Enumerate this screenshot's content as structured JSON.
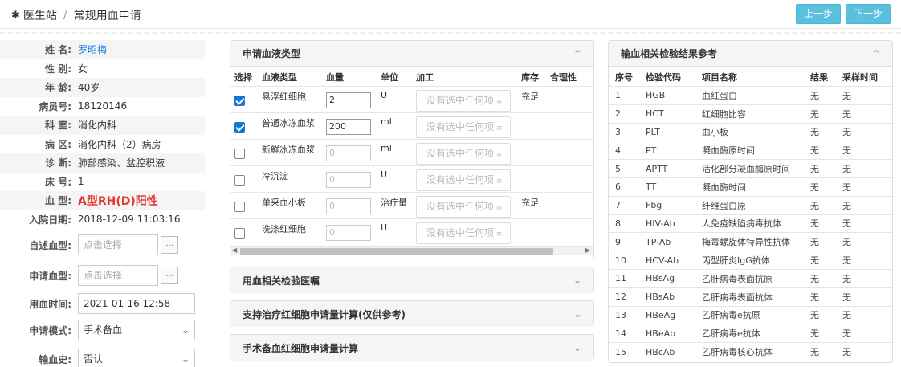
{
  "header": {
    "home": "医生站",
    "sep": "/",
    "page": "常规用血申请",
    "prev_label": "上一步",
    "next_label": "下一步"
  },
  "patient": {
    "fields": [
      {
        "label": "姓 名:",
        "value": "罗昭梅",
        "style": "name"
      },
      {
        "label": "性 别:",
        "value": "女"
      },
      {
        "label": "年 龄:",
        "value": "40岁"
      },
      {
        "label": "病员号:",
        "value": "18120146"
      },
      {
        "label": "科 室:",
        "value": "消化内科"
      },
      {
        "label": "病 区:",
        "value": "消化内科（2）病房"
      },
      {
        "label": "诊 断:",
        "value": "肺部感染、盆腔积液"
      },
      {
        "label": "床 号:",
        "value": "1"
      },
      {
        "label": "血 型:",
        "value": "A型RH(D)阳性",
        "style": "blood"
      },
      {
        "label": "入院日期:",
        "value": "2018-12-09 11:03:16"
      }
    ],
    "self_blood": {
      "label": "自述血型:",
      "placeholder": "点击选择"
    },
    "apply_blood": {
      "label": "申请血型:",
      "placeholder": "点击选择"
    },
    "use_time": {
      "label": "用血时间:",
      "value": "2021-01-16 12:58"
    },
    "mode": {
      "label": "申请模式:",
      "value": "手术备血"
    },
    "transfusion": {
      "label": "输血史:",
      "value": "否认"
    },
    "dots": "..."
  },
  "blood_panel": {
    "title": "申请血液类型",
    "columns": [
      "选择",
      "血液类型",
      "血量",
      "单位",
      "加工",
      "库存",
      "合理性"
    ],
    "proc_placeholder": "没有选中任何项",
    "rows": [
      {
        "checked": true,
        "type": "悬浮红细胞",
        "qty": "2",
        "unit": "U",
        "stock": "充足"
      },
      {
        "checked": true,
        "type": "普通冰冻血浆",
        "qty": "200",
        "unit": "ml",
        "stock": ""
      },
      {
        "checked": false,
        "type": "新鲜冰冻血浆",
        "qty": "0",
        "unit": "ml",
        "stock": ""
      },
      {
        "checked": false,
        "type": "冷沉淀",
        "qty": "0",
        "unit": "U",
        "stock": ""
      },
      {
        "checked": false,
        "type": "单采血小板",
        "qty": "0",
        "unit": "治疗量",
        "stock": "充足"
      },
      {
        "checked": false,
        "type": "洗涤红细胞",
        "qty": "0",
        "unit": "U",
        "stock": ""
      }
    ]
  },
  "collapsed_panels": [
    "用血相关检验医嘱",
    "支持治疗红细胞申请量计算(仅供参考)",
    "手术备血红细胞申请量计算"
  ],
  "ref_panel": {
    "title": "输血相关检验结果参考",
    "columns": [
      "序号",
      "检验代码",
      "项目名称",
      "结果",
      "采样时间"
    ],
    "rows": [
      [
        "1",
        "HGB",
        "血红蛋白",
        "无",
        "无"
      ],
      [
        "2",
        "HCT",
        "红细胞比容",
        "无",
        "无"
      ],
      [
        "3",
        "PLT",
        "血小板",
        "无",
        "无"
      ],
      [
        "4",
        "PT",
        "凝血酶原时间",
        "无",
        "无"
      ],
      [
        "5",
        "APTT",
        "活化部分凝血酶原时间",
        "无",
        "无"
      ],
      [
        "6",
        "TT",
        "凝血酶时间",
        "无",
        "无"
      ],
      [
        "7",
        "Fbg",
        "纤维蛋白原",
        "无",
        "无"
      ],
      [
        "8",
        "HIV-Ab",
        "人免疫缺陷病毒抗体",
        "无",
        "无"
      ],
      [
        "9",
        "TP-Ab",
        "梅毒螺旋体特异性抗体",
        "无",
        "无"
      ],
      [
        "10",
        "HCV-Ab",
        "丙型肝炎IgG抗体",
        "无",
        "无"
      ],
      [
        "11",
        "HBsAg",
        "乙肝病毒表面抗原",
        "无",
        "无"
      ],
      [
        "12",
        "HBsAb",
        "乙肝病毒表面抗体",
        "无",
        "无"
      ],
      [
        "13",
        "HBeAg",
        "乙肝病毒e抗原",
        "无",
        "无"
      ],
      [
        "14",
        "HBeAb",
        "乙肝病毒e抗体",
        "无",
        "无"
      ],
      [
        "15",
        "HBcAb",
        "乙肝病毒核心抗体",
        "无",
        "无"
      ]
    ]
  }
}
